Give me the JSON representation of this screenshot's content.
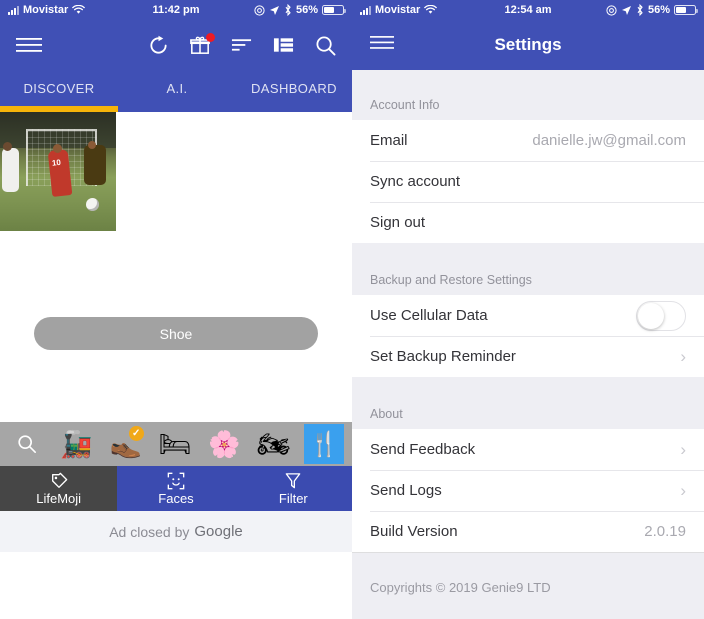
{
  "left": {
    "statusbar": {
      "carrier": "Movistar",
      "wifi_icon": "wifi-icon",
      "time": "11:42 pm",
      "location_icon": "location-arrow-icon",
      "alarm_icon": "do-not-disturb-icon",
      "bluetooth_icon": "bluetooth-icon",
      "battery_percent": "56%"
    },
    "toolbar": {
      "menu_icon": "hamburger-menu-icon",
      "refresh_icon": "refresh-icon",
      "gift_icon": "gift-icon",
      "gift_badge": true,
      "sort_icon": "sort-icon",
      "grid_icon": "list-view-icon",
      "search_icon": "search-icon"
    },
    "tabs": [
      {
        "label": "DISCOVER",
        "active": true
      },
      {
        "label": "A.I.",
        "active": false
      },
      {
        "label": "DASHBOARD",
        "active": false
      }
    ],
    "label_pill": "Shoe",
    "emoji_strip": [
      {
        "name": "search-icon",
        "glyph": "⌕",
        "selected": false
      },
      {
        "name": "tank-emoji",
        "glyph": "🚂",
        "selected": false
      },
      {
        "name": "shoe-emoji",
        "glyph": "👞",
        "selected": true,
        "check": "✓"
      },
      {
        "name": "bed-emoji",
        "glyph": "🛏",
        "selected": false
      },
      {
        "name": "flower-emoji",
        "glyph": "🌸",
        "selected": false
      },
      {
        "name": "motorcycle-emoji",
        "glyph": "🏍",
        "selected": false
      },
      {
        "name": "cutlery-emoji",
        "glyph": "🍴",
        "selected": false
      }
    ],
    "bottom_tabs": [
      {
        "label": "LifeMoji",
        "icon": "tag-icon",
        "active": true
      },
      {
        "label": "Faces",
        "icon": "face-scan-icon",
        "active": false
      },
      {
        "label": "Filter",
        "icon": "funnel-icon",
        "active": false
      }
    ],
    "ad": {
      "prefix": "Ad closed by",
      "brand": "Google"
    },
    "colors": {
      "header_blue": "#4050b5",
      "accent_yellow": "#f6b40a",
      "badge_red": "#ee1b24"
    }
  },
  "right": {
    "statusbar": {
      "carrier": "Movistar",
      "time": "12:54 am",
      "battery_percent": "56%"
    },
    "header": {
      "menu_icon": "hamburger-menu-icon",
      "title": "Settings"
    },
    "sections": [
      {
        "title": "Account Info",
        "rows": [
          {
            "label": "Email",
            "value": "danielle.jw@gmail.com",
            "type": "value"
          },
          {
            "label": "Sync account",
            "type": "plain"
          },
          {
            "label": "Sign out",
            "type": "plain"
          }
        ]
      },
      {
        "title": "Backup and Restore Settings",
        "rows": [
          {
            "label": "Use Cellular Data",
            "type": "toggle",
            "toggle_on": false
          },
          {
            "label": "Set Backup Reminder",
            "type": "chevron",
            "chevron": "›"
          }
        ]
      },
      {
        "title": "About",
        "rows": [
          {
            "label": "Send Feedback",
            "type": "chevron",
            "chevron": "›"
          },
          {
            "label": "Send Logs",
            "type": "chevron",
            "chevron": "›"
          },
          {
            "label": "Build Version",
            "value": "2.0.19",
            "type": "value"
          }
        ]
      }
    ],
    "copyright": "Copyrights © 2019 Genie9 LTD"
  }
}
